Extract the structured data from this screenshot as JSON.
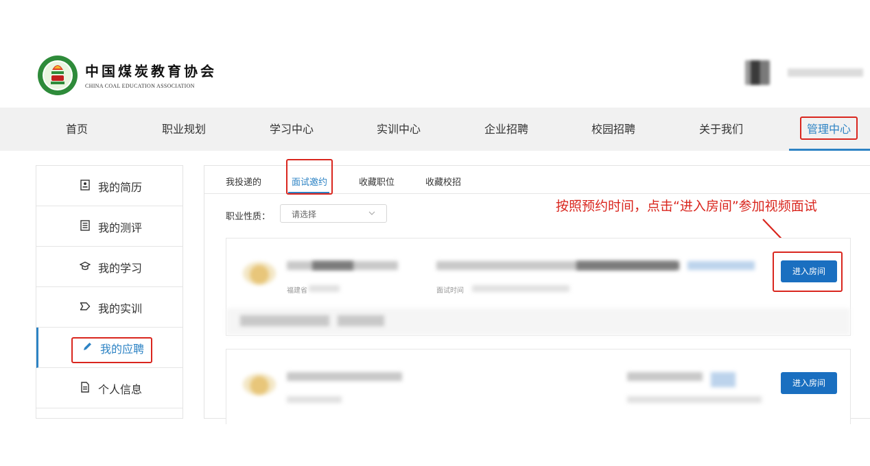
{
  "header": {
    "org_name_cn": "中国煤炭教育协会",
    "org_name_en": "CHINA COAL EDUCATION ASSOCIATION"
  },
  "nav": {
    "items": [
      {
        "label": "首页"
      },
      {
        "label": "职业规划"
      },
      {
        "label": "学习中心"
      },
      {
        "label": "实训中心"
      },
      {
        "label": "企业招聘"
      },
      {
        "label": "校园招聘"
      },
      {
        "label": "关于我们"
      },
      {
        "label": "管理中心",
        "active": true
      }
    ]
  },
  "sidebar": {
    "items": [
      {
        "label": "我的简历",
        "icon": "resume-icon"
      },
      {
        "label": "我的测评",
        "icon": "assessment-icon"
      },
      {
        "label": "我的学习",
        "icon": "graduation-cap-icon"
      },
      {
        "label": "我的实训",
        "icon": "tag-icon"
      },
      {
        "label": "我的应聘",
        "icon": "pencil-icon",
        "active": true
      },
      {
        "label": "个人信息",
        "icon": "document-icon"
      }
    ]
  },
  "tabs": [
    {
      "label": "我投递的"
    },
    {
      "label": "面试邀约",
      "active": true
    },
    {
      "label": "收藏职位"
    },
    {
      "label": "收藏校招"
    }
  ],
  "filter": {
    "label": "职业性质：",
    "placeholder": "请选择"
  },
  "annotation": "按照预约时间，点击“进入房间”参加视频面试",
  "cards": [
    {
      "location_label": "福建省",
      "interview_time_label": "面试时间",
      "enter_button": "进入房间"
    },
    {
      "enter_button": "进入房间"
    }
  ],
  "colors": {
    "accent": "#2d83c4",
    "button": "#1a6fc0",
    "highlight": "#d9251d",
    "nav_bg": "#f1f1f1"
  }
}
